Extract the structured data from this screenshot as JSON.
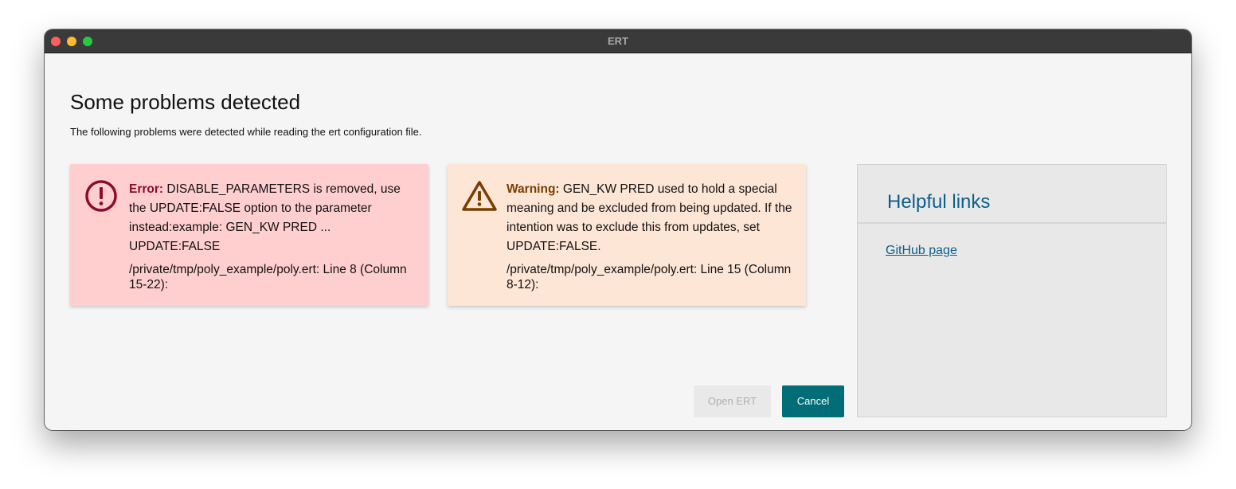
{
  "window": {
    "title": "ERT"
  },
  "dialog": {
    "heading": "Some problems detected",
    "subheading": "The following problems were detected while reading the ert configuration file."
  },
  "problems": [
    {
      "severity": "Error:",
      "message": "DISABLE_PARAMETERS is removed, use the UPDATE:FALSE option to the parameter instead:example: GEN_KW PRED ... UPDATE:FALSE",
      "location": "/private/tmp/poly_example/poly.ert: Line 8 (Column 15-22):",
      "icon": "error-circle-icon",
      "color": "#8e0b2c"
    },
    {
      "severity": "Warning:",
      "message": "GEN_KW PRED used to hold a special meaning and be excluded from being updated. If the intention was to exclude this from updates, set UPDATE:FALSE.",
      "location": "/private/tmp/poly_example/poly.ert: Line 15 (Column 8-12):",
      "icon": "warning-triangle-icon",
      "color": "#7a3d00"
    }
  ],
  "buttons": {
    "open": "Open ERT",
    "cancel": "Cancel"
  },
  "links": {
    "title": "Helpful links",
    "items": [
      "GitHub page"
    ]
  },
  "colors": {
    "error_bg": "#ffcfd0",
    "warning_bg": "#fee6d6",
    "accent": "#006d77",
    "link": "#0b5f8a"
  }
}
